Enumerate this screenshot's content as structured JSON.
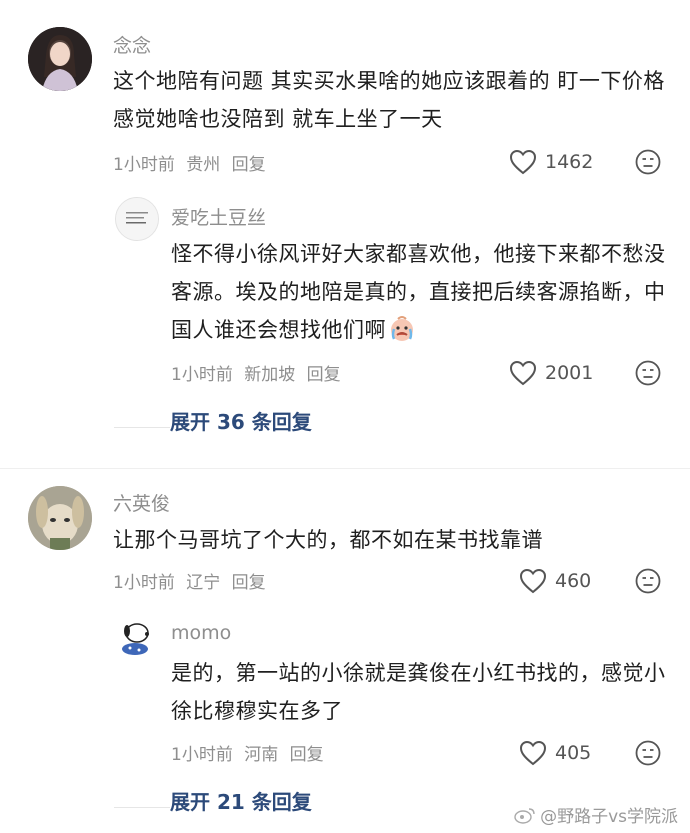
{
  "comments": [
    {
      "name": "念念",
      "text": "这个地陪有问题  其实买水果啥的她应该跟着的  盯一下价格  感觉她啥也没陪到 就车上坐了一天",
      "time": "1小时前",
      "location": "贵州",
      "reply": "回复",
      "likes": "1462",
      "avatar": "woman-avatar"
    },
    {
      "name": "爱吃土豆丝",
      "text": "怪不得小徐风评好大家都喜欢他，他接下来都不愁没客源。埃及的地陪是真的，直接把后续客源掐断，中国人谁还会想找他们啊",
      "emoji": "crying-baby-emoji",
      "time": "1小时前",
      "location": "新加坡",
      "reply": "回复",
      "likes": "2001",
      "avatar": "text-card-avatar"
    },
    {
      "name": "六英俊",
      "text": "让那个马哥坑了个大的，都不如在某书找靠谱",
      "time": "1小时前",
      "location": "辽宁",
      "reply": "回复",
      "likes": "460",
      "avatar": "cartoon-dog-avatar"
    },
    {
      "name": "momo",
      "text": "是的，第一站的小徐就是龚俊在小红书找的，感觉小徐比穆穆实在多了",
      "time": "1小时前",
      "location": "河南",
      "reply": "回复",
      "likes": "405",
      "avatar": "snoopy-avatar"
    }
  ],
  "expand_replies": [
    {
      "label": "展开 36 条回复"
    },
    {
      "label": "展开 21 条回复"
    }
  ],
  "watermark": "@野路子vs学院派",
  "colors": {
    "accent_link": "#2c4a7a",
    "meta_gray": "#8e8e8e"
  }
}
